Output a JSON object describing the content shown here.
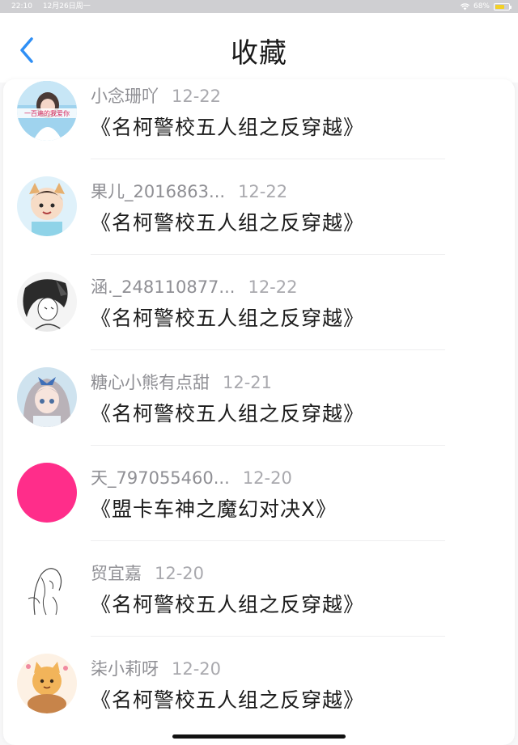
{
  "status_bar": {
    "time": "22:10",
    "date": "12月26日周一",
    "battery": "68%",
    "battery_level": 0.68
  },
  "nav": {
    "title": "收藏"
  },
  "items": [
    {
      "user": "小念珊吖",
      "date": "12-22",
      "title": "《名柯警校五人组之反穿越》",
      "avatar_banner": "一百遍的我爱你"
    },
    {
      "user": "果儿_2016863...",
      "date": "12-22",
      "title": "《名柯警校五人组之反穿越》"
    },
    {
      "user": "涵._248110877...",
      "date": "12-22",
      "title": "《名柯警校五人组之反穿越》"
    },
    {
      "user": "糖心小熊有点甜",
      "date": "12-21",
      "title": "《名柯警校五人组之反穿越》"
    },
    {
      "user": "天_797055460...",
      "date": "12-20",
      "title": "《盟卡车神之魔幻对决X》"
    },
    {
      "user": "贸宜嘉",
      "date": "12-20",
      "title": "《名柯警校五人组之反穿越》"
    },
    {
      "user": "柒小莉呀",
      "date": "12-20",
      "title": "《名柯警校五人组之反穿越》"
    }
  ],
  "colors": {
    "accent_back": "#2f8ff5",
    "avatar_pink": "#ff2d8a"
  }
}
